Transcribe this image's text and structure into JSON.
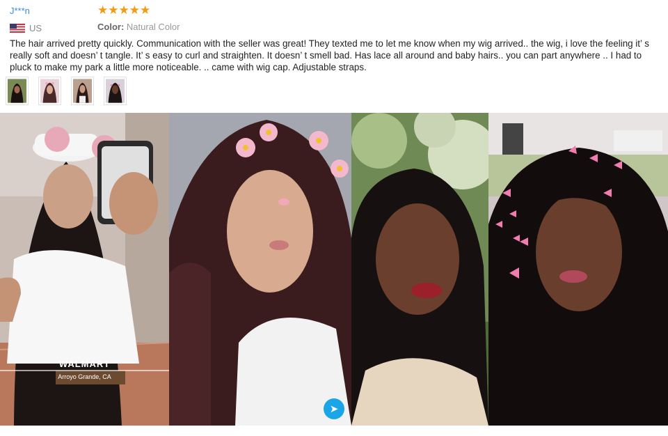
{
  "review": {
    "username": "J***n",
    "rating": 5,
    "country": "US",
    "color_label": "Color:",
    "color_value": "Natural Color",
    "text": "The hair arrived pretty quickly. Communication with the seller was great! They texted me to let me know when my wig arrived.. the wig, i love the feeling it’ s really soft and doesn’ t tangle. It’ s easy to curl and straighten. It doesn’ t smell bad. Has lace all around and baby hairs.. you can part anywhere .. I had to pluck to make my park a little more noticeable. .. came with wig cap. Adjustable straps."
  },
  "photos": [
    {
      "geofilter_title": "WALMART",
      "geofilter_subtitle": "Arroyo Grande, CA"
    }
  ],
  "colors": {
    "star": "#f29a12",
    "username": "#3a8fd6",
    "share_button": "#1aa5e6"
  }
}
